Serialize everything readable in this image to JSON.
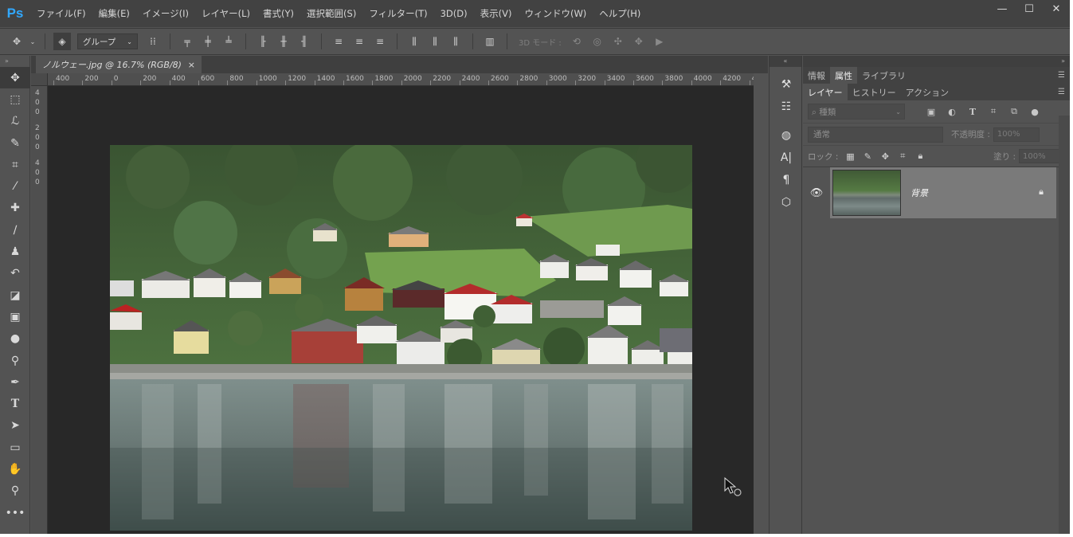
{
  "app": {
    "logo": "Ps"
  },
  "menu": [
    "ファイル(F)",
    "編集(E)",
    "イメージ(I)",
    "レイヤー(L)",
    "書式(Y)",
    "選択範囲(S)",
    "フィルター(T)",
    "3D(D)",
    "表示(V)",
    "ウィンドウ(W)",
    "ヘルプ(H)"
  ],
  "window_controls": {
    "minimize": "—",
    "maximize": "☐",
    "close": "✕"
  },
  "options_bar": {
    "autoselect_value": "グループ",
    "mode3d_label": "3D モード :"
  },
  "document": {
    "tab_title": "ノルウェー.jpg @ 16.7% (RGB/8)",
    "tab_close": "×",
    "ruler_top_labels": [
      "400",
      "200",
      "0",
      "200",
      "400",
      "600",
      "800",
      "1000",
      "1200",
      "1400",
      "1600",
      "1800",
      "2000",
      "2200",
      "2400",
      "2600",
      "2800",
      "3000",
      "3200",
      "3400",
      "3600",
      "3800",
      "4000",
      "4200",
      "4400"
    ],
    "ruler_left_labels": [
      "4",
      "0",
      "0",
      "2",
      "0",
      "0",
      "4",
      "0",
      "0"
    ]
  },
  "panels": {
    "top_tabs": [
      "情報",
      "属性",
      "ライブラリ"
    ],
    "top_active": "属性",
    "layer_tabs": [
      "レイヤー",
      "ヒストリー",
      "アクション"
    ],
    "layer_active": "レイヤー",
    "filter_placeholder": "種類",
    "blend_mode": "通常",
    "opacity_label": "不透明度 :",
    "opacity_value": "100%",
    "lock_label": "ロック :",
    "fill_label": "塗り :",
    "fill_value": "100%",
    "layers": [
      {
        "name": "背景",
        "visible": true,
        "locked": true
      }
    ]
  },
  "icons": {
    "left_tools": [
      "move-icon",
      "marquee-icon",
      "lasso-icon",
      "quick-select-icon",
      "crop-icon",
      "eyedropper-icon",
      "healing-brush-icon",
      "brush-icon",
      "stamp-icon",
      "history-brush-icon",
      "eraser-icon",
      "gradient-icon",
      "blur-icon",
      "dodge-icon",
      "pen-icon",
      "type-icon",
      "path-select-icon",
      "rectangle-icon",
      "hand-icon",
      "zoom-icon",
      "more-tools-icon"
    ],
    "side_strip": [
      "brush-presets-icon",
      "adjustments-icon",
      "swatches-icon",
      "character-icon",
      "paragraph-icon",
      "3d-icon"
    ]
  },
  "colors": {
    "ps_blue": "#31a8ff",
    "ui_bg": "#535353",
    "menubar_bg": "#424242",
    "canvas_bg": "#282828"
  }
}
